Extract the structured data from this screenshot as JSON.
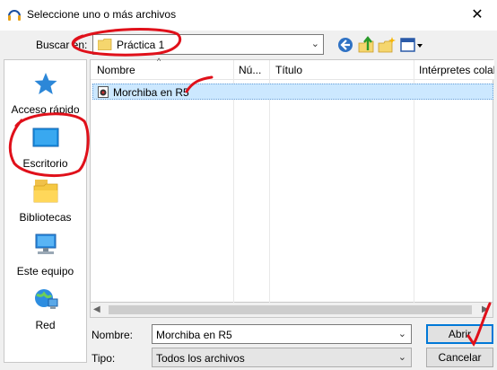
{
  "window": {
    "title": "Seleccione uno o más archivos",
    "close_glyph": "✕"
  },
  "lookin": {
    "label": "Buscar en:",
    "value": "Práctica 1"
  },
  "toolbar": {
    "icons": [
      "back-icon",
      "up-folder-icon",
      "new-folder-icon",
      "view-menu-icon"
    ]
  },
  "places": [
    {
      "label": "Acceso rápido",
      "icon": "star-icon"
    },
    {
      "label": "Escritorio",
      "icon": "desktop-icon"
    },
    {
      "label": "Bibliotecas",
      "icon": "libraries-icon"
    },
    {
      "label": "Este equipo",
      "icon": "computer-icon"
    },
    {
      "label": "Red",
      "icon": "network-icon"
    }
  ],
  "filelist": {
    "columns": [
      "Nombre",
      "Nú...",
      "Título",
      "Intérpretes colab"
    ],
    "rows": [
      {
        "name": "Morchiba en R5",
        "selected": true
      }
    ]
  },
  "fields": {
    "name_label": "Nombre:",
    "name_value": "Morchiba en R5",
    "type_label": "Tipo:",
    "type_value": "Todos los archivos"
  },
  "buttons": {
    "open": "Abrir",
    "cancel": "Cancelar"
  },
  "colors": {
    "selection": "#cce8ff",
    "accent": "#0078d7",
    "annotation": "#e0101a"
  }
}
